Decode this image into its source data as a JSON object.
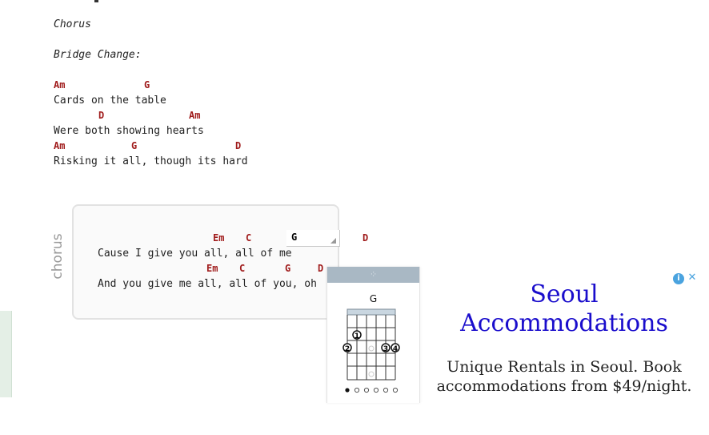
{
  "section_chorus": "Chorus",
  "section_bridge": "Bridge Change:",
  "verse": {
    "l1_chords": [
      "Am",
      "G"
    ],
    "l1_lyric": "Cards on the table",
    "l2_chords": [
      "D",
      "Am"
    ],
    "l2_lyric": "Were both showing hearts",
    "l3_chords": [
      "Am",
      "G",
      "D"
    ],
    "l3_lyric": "Risking it all, though its hard"
  },
  "chorus_box": {
    "label": "chorus",
    "l1_chords": [
      "Em",
      "C",
      "D"
    ],
    "l1_lyric": "Cause I give you all, all of me",
    "l2_chords": [
      "Em",
      "C",
      "G",
      "D"
    ],
    "l2_lyric": "And you give me all, all of you, oh"
  },
  "chord_select": {
    "value": "G"
  },
  "chord_diagram": {
    "name": "G",
    "finger_labels": [
      "1",
      "2",
      "3",
      "4"
    ]
  },
  "ad": {
    "title": "Seoul Accommodations",
    "description": "Unique Rentals in Seoul. Book accommodations from $49/night.",
    "info_icon": "i",
    "close_icon": "✕"
  },
  "colors": {
    "chord": "#a01c1c",
    "ad_title": "#1a0dcc",
    "diagram_header": "#a9b8c4"
  }
}
